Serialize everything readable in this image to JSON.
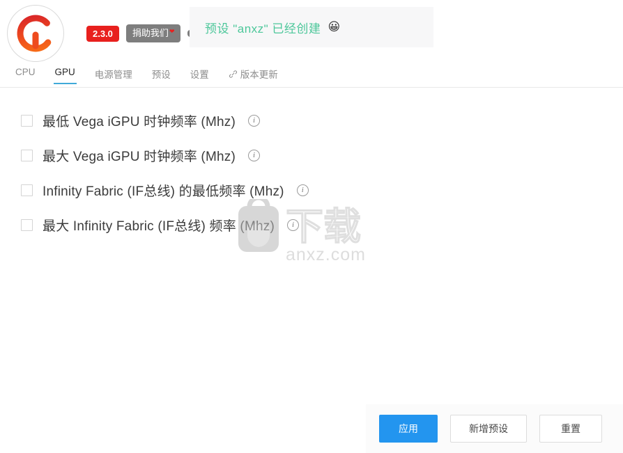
{
  "header": {
    "logo_name": "ryzen-controller-logo",
    "version_badge": "2.3.0",
    "donate_label": "捐助我们",
    "donate_heart": "❤",
    "third_pill_label": ""
  },
  "toast": {
    "message": "预设 \"anxz\" 已经创建",
    "emoji": "😀"
  },
  "tabs": [
    {
      "label": "CPU",
      "active": false,
      "icon": ""
    },
    {
      "label": "GPU",
      "active": true,
      "icon": ""
    },
    {
      "label": "电源管理",
      "active": false,
      "icon": ""
    },
    {
      "label": "预设",
      "active": false,
      "icon": ""
    },
    {
      "label": "设置",
      "active": false,
      "icon": ""
    },
    {
      "label": "版本更新",
      "active": false,
      "icon": "link-icon"
    }
  ],
  "options": [
    {
      "label": "最低 Vega iGPU 时钟频率 (Mhz)",
      "checked": false,
      "info": "i"
    },
    {
      "label": "最大 Vega iGPU 时钟频率 (Mhz)",
      "checked": false,
      "info": "i"
    },
    {
      "label": " Infinity Fabric (IF总线) 的最低频率 (Mhz)",
      "checked": false,
      "info": "i"
    },
    {
      "label": "最大 Infinity Fabric (IF总线) 频率 (Mhz)",
      "checked": false,
      "info": "i"
    }
  ],
  "watermark": {
    "site": "anxz.com",
    "cn_text": "下载"
  },
  "footer": {
    "apply_label": "应用",
    "new_preset_label": "新增预设",
    "reset_label": "重置"
  },
  "colors": {
    "primary": "#2395ef",
    "danger": "#e8201e",
    "success": "#4cc79a",
    "tab_active_underline": "#40a9d8",
    "pill_gray": "#7e7e7e"
  }
}
